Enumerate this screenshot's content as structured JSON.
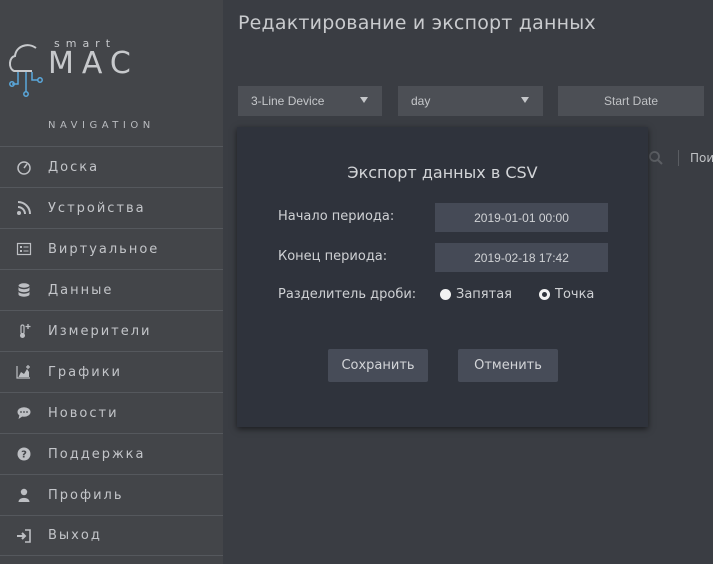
{
  "logo": {
    "top_text": "smart",
    "main_text": "MAC"
  },
  "sidebar": {
    "heading": "NAVIGATION",
    "items": [
      {
        "label": "Доска",
        "icon": "dashboard-icon"
      },
      {
        "label": "Устройства",
        "icon": "rss-icon"
      },
      {
        "label": "Виртуальное",
        "icon": "list-icon"
      },
      {
        "label": "Данные",
        "icon": "database-icon"
      },
      {
        "label": "Измерители",
        "icon": "thermometer-icon"
      },
      {
        "label": "Графики",
        "icon": "area-chart-icon"
      },
      {
        "label": "Новости",
        "icon": "comment-icon"
      },
      {
        "label": "Поддержка",
        "icon": "question-icon"
      },
      {
        "label": "Профиль",
        "icon": "user-icon"
      },
      {
        "label": "Выход",
        "icon": "sign-out-icon"
      }
    ]
  },
  "main": {
    "title": "Редактирование и экспорт данных",
    "device_select": "3-Line Device",
    "period_select": "day",
    "start_date_button": "Start Date",
    "search_text": "Пои"
  },
  "modal": {
    "title": "Экспорт данных в CSV",
    "start_label": "Начало периода:",
    "start_value": "2019-01-01 00:00",
    "end_label": "Конец периода:",
    "end_value": "2019-02-18 17:42",
    "separator_label": "Разделитель дроби:",
    "option_comma": "Запятая",
    "option_dot": "Точка",
    "selected_option": "Точка",
    "save_button": "Сохранить",
    "cancel_button": "Отменить"
  }
}
